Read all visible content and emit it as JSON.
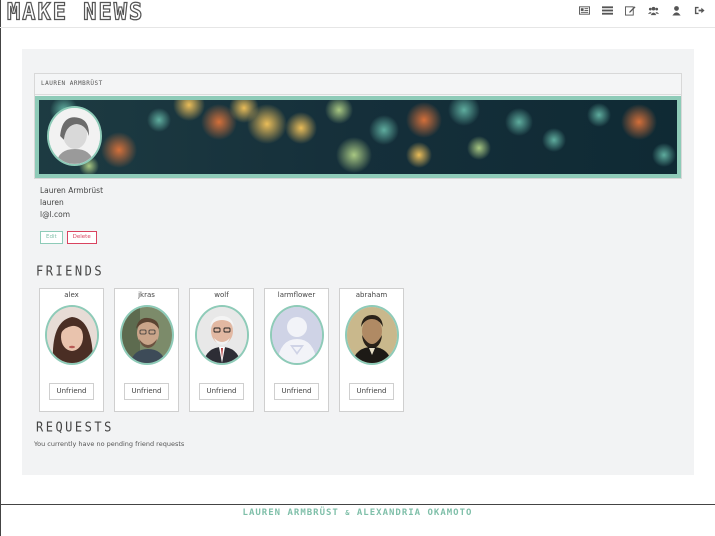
{
  "header": {
    "brand": "MAKE NEWS",
    "nav_icons": [
      "news-feed-icon",
      "list-icon",
      "edit-icon",
      "users-icon",
      "user-icon",
      "sign-out-icon"
    ]
  },
  "profile": {
    "card_title": "LAUREN ARMBRÜST",
    "full_name": "Lauren Armbrüst",
    "username": "lauren",
    "email": "l@l.com",
    "edit_label": "Edit",
    "delete_label": "Delete"
  },
  "friends": {
    "title": "FRIENDS",
    "items": [
      {
        "name": "alex",
        "action": "Unfriend"
      },
      {
        "name": "jkras",
        "action": "Unfriend"
      },
      {
        "name": "wolf",
        "action": "Unfriend"
      },
      {
        "name": "larmflower",
        "action": "Unfriend"
      },
      {
        "name": "abraham",
        "action": "Unfriend"
      }
    ]
  },
  "requests": {
    "title": "REQUESTS",
    "empty_text": "You currently have no pending friend requests"
  },
  "footer": {
    "author1": "LAUREN ARMBRÜST",
    "amp": "&",
    "author2": "ALEXANDRIA OKAMOTO"
  },
  "colors": {
    "accent": "#8ecbb8",
    "danger": "#d9435f",
    "panel": "#f2f3f4"
  }
}
